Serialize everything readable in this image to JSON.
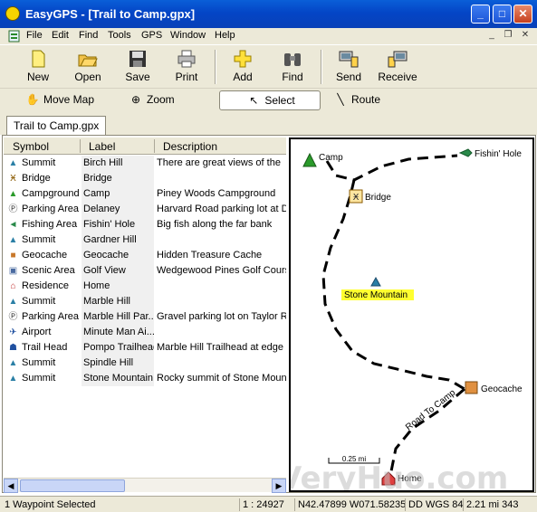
{
  "window": {
    "title": "EasyGPS - [Trail to Camp.gpx]",
    "min": "_",
    "max": "□",
    "close": "✕"
  },
  "menu": [
    "File",
    "Edit",
    "Find",
    "Tools",
    "GPS",
    "Window",
    "Help"
  ],
  "mdi": {
    "min": "_",
    "restore": "❐",
    "close": "✕"
  },
  "toolbar": {
    "new": "New",
    "open": "Open",
    "save": "Save",
    "print": "Print",
    "add": "Add",
    "find": "Find",
    "send": "Send",
    "receive": "Receive"
  },
  "modes": {
    "move": "Move Map",
    "zoom": "Zoom",
    "select": "Select",
    "route": "Route"
  },
  "tab": "Trail to Camp.gpx",
  "columns": {
    "symbol": "Symbol",
    "label": "Label",
    "description": "Description"
  },
  "rows": [
    {
      "symbol": "Summit",
      "label": "Birch Hill",
      "description": "There are great views of the",
      "icon": "summit-icon",
      "glyph": "▲",
      "color": "#2a7fa5"
    },
    {
      "symbol": "Bridge",
      "label": "Bridge",
      "description": "",
      "icon": "bridge-icon",
      "glyph": "Ӿ",
      "color": "#8a5a00"
    },
    {
      "symbol": "Campground",
      "label": "Camp",
      "description": "Piney Woods Campground",
      "icon": "tent-icon",
      "glyph": "▲",
      "color": "#2a9a2a"
    },
    {
      "symbol": "Parking Area",
      "label": "Delaney",
      "description": "Harvard Road parking lot at D",
      "icon": "parking-icon",
      "glyph": "Ⓟ",
      "color": "#333"
    },
    {
      "symbol": "Fishing Area",
      "label": "Fishin' Hole",
      "description": "Big fish along the far bank",
      "icon": "fish-icon",
      "glyph": "◄",
      "color": "#2a8a4a"
    },
    {
      "symbol": "Summit",
      "label": "Gardner Hill",
      "description": "",
      "icon": "summit-icon",
      "glyph": "▲",
      "color": "#2a7fa5"
    },
    {
      "symbol": "Geocache",
      "label": "Geocache",
      "description": "Hidden Treasure Cache",
      "icon": "geocache-icon",
      "glyph": "■",
      "color": "#c8782a"
    },
    {
      "symbol": "Scenic Area",
      "label": "Golf View",
      "description": "Wedgewood Pines Golf Cours",
      "icon": "scenic-icon",
      "glyph": "▣",
      "color": "#4a6aa0"
    },
    {
      "symbol": "Residence",
      "label": "Home",
      "description": "",
      "icon": "house-icon",
      "glyph": "⌂",
      "color": "#c03030"
    },
    {
      "symbol": "Summit",
      "label": "Marble Hill",
      "description": "",
      "icon": "summit-icon",
      "glyph": "▲",
      "color": "#2a7fa5"
    },
    {
      "symbol": "Parking Area",
      "label": "Marble Hill Par...",
      "description": "Gravel parking lot on Taylor R",
      "icon": "parking-icon",
      "glyph": "Ⓟ",
      "color": "#333"
    },
    {
      "symbol": "Airport",
      "label": "Minute Man Ai...",
      "description": "",
      "icon": "airplane-icon",
      "glyph": "✈",
      "color": "#2050a0"
    },
    {
      "symbol": "Trail Head",
      "label": "Pompo Trailhead",
      "description": "Marble Hill Trailhead at edge o",
      "icon": "hiker-icon",
      "glyph": "☗",
      "color": "#2050a0"
    },
    {
      "symbol": "Summit",
      "label": "Spindle Hill",
      "description": "",
      "icon": "summit-icon",
      "glyph": "▲",
      "color": "#2a7fa5"
    },
    {
      "symbol": "Summit",
      "label": "Stone Mountain",
      "description": "Rocky summit of Stone Mount",
      "icon": "summit-icon",
      "glyph": "▲",
      "color": "#2a7fa5"
    }
  ],
  "map": {
    "camp": "Camp",
    "fish": "Fishin' Hole",
    "bridge": "Bridge",
    "stone": "Stone Mountain",
    "geocache": "Geocache",
    "road": "Road To Camp",
    "home": "Home",
    "scale": "0.25 mi"
  },
  "status": {
    "selected": "1 Waypoint Selected",
    "scale": "1 : 24927",
    "coords": "N42.47899  W071.58235",
    "datum": "DD WGS 84",
    "distance": "2.21 mi 343"
  },
  "watermark": "VeryHuo.com"
}
